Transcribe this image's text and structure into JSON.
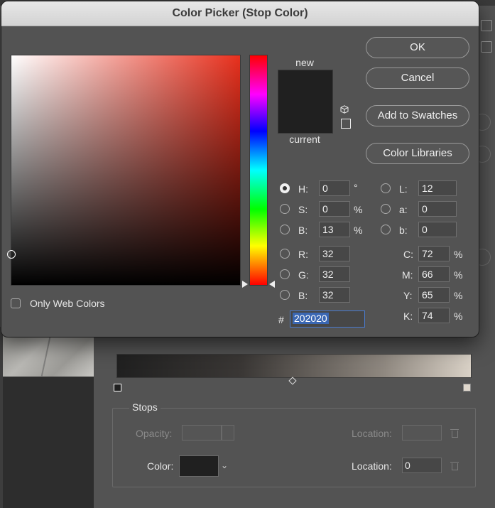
{
  "dialog": {
    "title": "Color Picker (Stop Color)",
    "buttons": {
      "ok": "OK",
      "cancel": "Cancel",
      "add_to_swatches": "Add to Swatches",
      "color_libraries": "Color Libraries"
    },
    "preview": {
      "new_label": "new",
      "current_label": "current",
      "new_color": "#202020",
      "current_color": "#202020"
    },
    "hsb": {
      "h": {
        "label": "H:",
        "value": "0",
        "unit": "°"
      },
      "s": {
        "label": "S:",
        "value": "0",
        "unit": "%"
      },
      "b": {
        "label": "B:",
        "value": "13",
        "unit": "%"
      }
    },
    "lab": {
      "l": {
        "label": "L:",
        "value": "12"
      },
      "a": {
        "label": "a:",
        "value": "0"
      },
      "b": {
        "label": "b:",
        "value": "0"
      }
    },
    "rgb": {
      "r": {
        "label": "R:",
        "value": "32"
      },
      "g": {
        "label": "G:",
        "value": "32"
      },
      "b": {
        "label": "B:",
        "value": "32"
      }
    },
    "cmyk": {
      "c": {
        "label": "C:",
        "value": "72",
        "unit": "%"
      },
      "m": {
        "label": "M:",
        "value": "66",
        "unit": "%"
      },
      "y": {
        "label": "Y:",
        "value": "65",
        "unit": "%"
      },
      "k": {
        "label": "K:",
        "value": "74",
        "unit": "%"
      }
    },
    "hex": {
      "label": "#",
      "value": "202020"
    },
    "only_web_colors": {
      "label": "Only Web Colors",
      "checked": false
    },
    "selected_model": "H",
    "field_hue_color": "#e8301d"
  },
  "gradient_editor": {
    "stops_title": "Stops",
    "opacity_label": "Opacity:",
    "opacity_location_label": "Location:",
    "color_label": "Color:",
    "color_location_label": "Location:",
    "color_location_value": "0",
    "stop_color": "#202020"
  }
}
